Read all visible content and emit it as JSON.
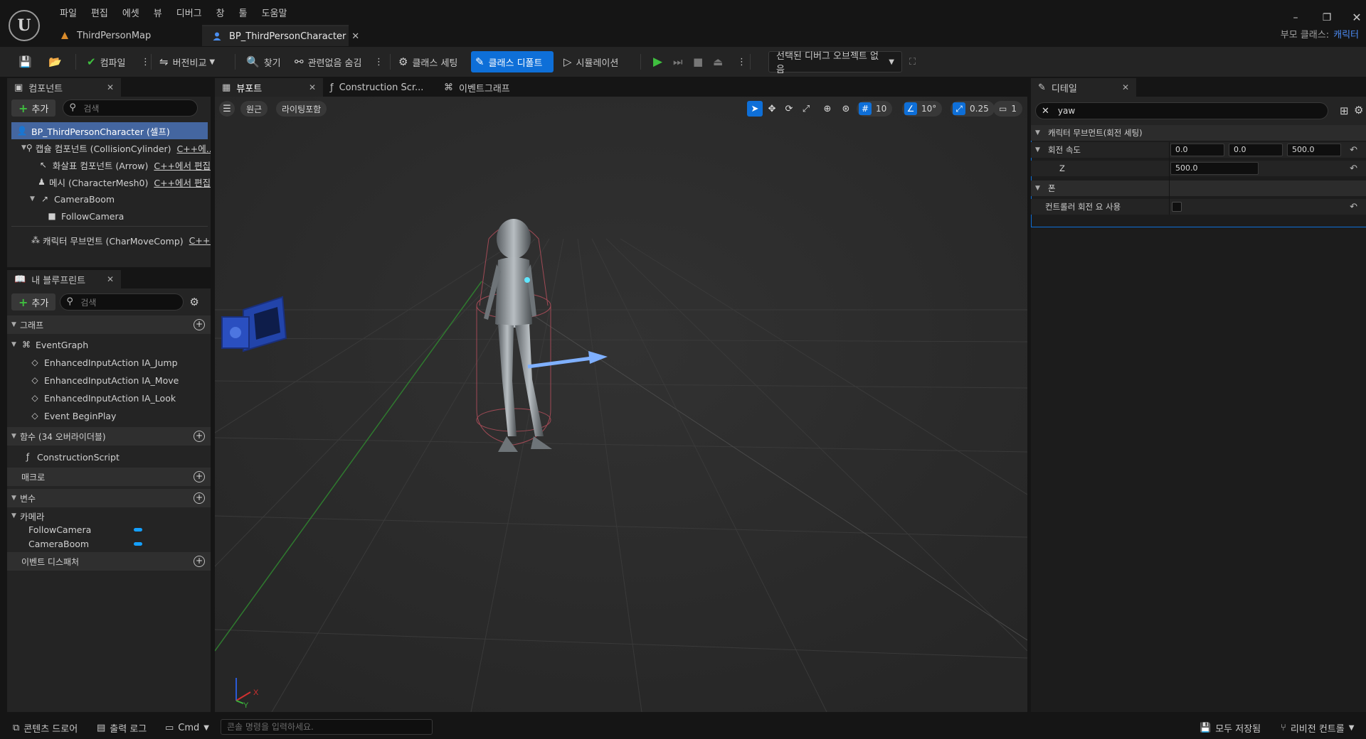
{
  "menu": [
    "파일",
    "편집",
    "에셋",
    "뷰",
    "디버그",
    "창",
    "툴",
    "도움말"
  ],
  "doc_tabs": {
    "map": "ThirdPersonMap",
    "blueprint": "BP_ThirdPersonCharacter"
  },
  "parent_class": {
    "label": "부모 클래스:",
    "value": "캐릭터"
  },
  "toolbar": {
    "compile": "컴파일",
    "diff": "버전비교",
    "find": "찾기",
    "hide_unrelated": "관련없음 숨김",
    "class_settings": "클래스 세팅",
    "class_defaults": "클래스 디폴트",
    "simulation": "시뮬레이션",
    "debug_object": "선택된 디버그 오브젝트 없음"
  },
  "components_panel": {
    "title": "컴포넌트",
    "add": "추가",
    "search_placeholder": "검색",
    "rows": [
      {
        "label": "BP_ThirdPersonCharacter (셀프)"
      },
      {
        "label": "캡슐 컴포넌트 (CollisionCylinder)",
        "edit": "C++에..."
      },
      {
        "label": "화살표 컴포넌트 (Arrow)",
        "edit": "C++에서 편집"
      },
      {
        "label": "메시 (CharacterMesh0)",
        "edit": "C++에서 편집"
      },
      {
        "label": "CameraBoom"
      },
      {
        "label": "FollowCamera"
      },
      {
        "label": "캐릭터 무브먼트 (CharMoveComp)",
        "edit": "C++C"
      }
    ]
  },
  "my_blueprint": {
    "title": "내 블루프린트",
    "add": "추가",
    "search_placeholder": "검색",
    "graphs_header": "그래프",
    "event_graph": "EventGraph",
    "events": [
      "EnhancedInputAction IA_Jump",
      "EnhancedInputAction IA_Move",
      "EnhancedInputAction IA_Look",
      "Event BeginPlay"
    ],
    "functions_header": "함수 (34 오버라이더블)",
    "construction_script": "ConstructionScript",
    "macros_header": "매크로",
    "variables_header": "변수",
    "camera_category": "카메라",
    "variables": [
      "FollowCamera",
      "CameraBoom"
    ],
    "dispatchers_header": "이벤트 디스패처"
  },
  "center_tabs": {
    "viewport": "뷰포트",
    "construction": "Construction Scr...",
    "event_graph": "이벤트그래프"
  },
  "viewport": {
    "perspective": "원근",
    "lit": "라이팅포함",
    "grid_snap": "10",
    "rot_snap": "10°",
    "scale_snap": "0.25",
    "camera_speed": "1",
    "gizmo_x": "X",
    "gizmo_y": "Y"
  },
  "details": {
    "title": "디테일",
    "search_value": "yaw",
    "category1": "캐릭터 무브먼트(회전 세팅)",
    "rotation_rate_label": "회전 속도",
    "rot_x": "0.0",
    "rot_y": "0.0",
    "rot_z": "500.0",
    "z_label": "Z",
    "z_value": "500.0",
    "category2": "폰",
    "use_controller_label": "컨트롤러 회전 요 사용",
    "use_controller_checked": false
  },
  "statusbar": {
    "content_drawer": "콘텐츠 드로어",
    "output_log": "출력 로그",
    "cmd": "Cmd",
    "console_placeholder": "콘솔 명령을 입력하세요.",
    "all_saved": "모두 저장됨",
    "revision": "리비전 컨트롤"
  },
  "colors": {
    "accent": "#0e6fd8",
    "selection": "#4466a0",
    "var_pill": "#14a0ff",
    "play": "#3fbf3f"
  }
}
